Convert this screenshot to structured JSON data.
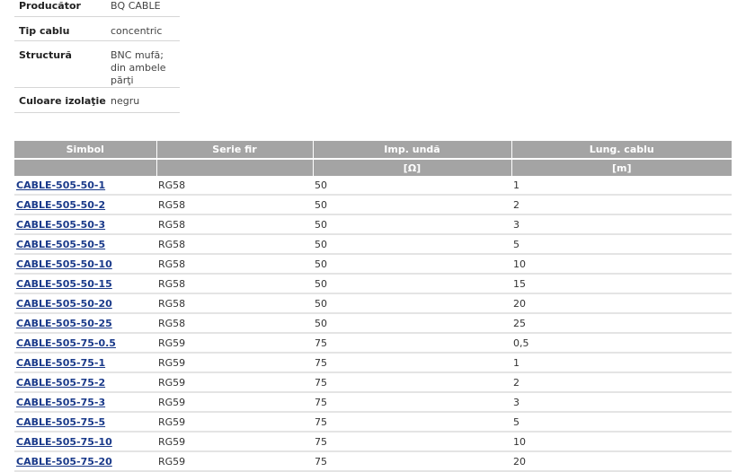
{
  "specs": [
    {
      "label": "Producător",
      "value_lines": [
        "BQ CABLE"
      ]
    },
    {
      "label": "Tip cablu",
      "value_lines": [
        "concentric"
      ]
    },
    {
      "label": "Structură",
      "value_lines": [
        "BNC mufă;",
        "din ambele părţi"
      ]
    },
    {
      "label": "Culoare izolaţie",
      "value_lines": [
        "negru"
      ]
    }
  ],
  "table": {
    "headers": [
      "Simbol",
      "Serie fir",
      "Imp. undă",
      "Lung. cablu"
    ],
    "units": [
      "",
      "",
      "[Ω]",
      "[m]"
    ],
    "rows": [
      {
        "symbol": "CABLE-505-50-1",
        "series": "RG58",
        "imp": "50",
        "length": "1"
      },
      {
        "symbol": "CABLE-505-50-2",
        "series": "RG58",
        "imp": "50",
        "length": "2"
      },
      {
        "symbol": "CABLE-505-50-3",
        "series": "RG58",
        "imp": "50",
        "length": "3"
      },
      {
        "symbol": "CABLE-505-50-5",
        "series": "RG58",
        "imp": "50",
        "length": "5"
      },
      {
        "symbol": "CABLE-505-50-10",
        "series": "RG58",
        "imp": "50",
        "length": "10"
      },
      {
        "symbol": "CABLE-505-50-15",
        "series": "RG58",
        "imp": "50",
        "length": "15"
      },
      {
        "symbol": "CABLE-505-50-20",
        "series": "RG58",
        "imp": "50",
        "length": "20"
      },
      {
        "symbol": "CABLE-505-50-25",
        "series": "RG58",
        "imp": "50",
        "length": "25"
      },
      {
        "symbol": "CABLE-505-75-0.5",
        "series": "RG59",
        "imp": "75",
        "length": "0,5"
      },
      {
        "symbol": "CABLE-505-75-1",
        "series": "RG59",
        "imp": "75",
        "length": "1"
      },
      {
        "symbol": "CABLE-505-75-2",
        "series": "RG59",
        "imp": "75",
        "length": "2"
      },
      {
        "symbol": "CABLE-505-75-3",
        "series": "RG59",
        "imp": "75",
        "length": "3"
      },
      {
        "symbol": "CABLE-505-75-5",
        "series": "RG59",
        "imp": "75",
        "length": "5"
      },
      {
        "symbol": "CABLE-505-75-10",
        "series": "RG59",
        "imp": "75",
        "length": "10"
      },
      {
        "symbol": "CABLE-505-75-20",
        "series": "RG59",
        "imp": "75",
        "length": "20"
      }
    ]
  },
  "colors": {
    "header_bg": "#a4a4a4",
    "link": "#1a3a8a",
    "row_border": "#e4e4e4"
  }
}
